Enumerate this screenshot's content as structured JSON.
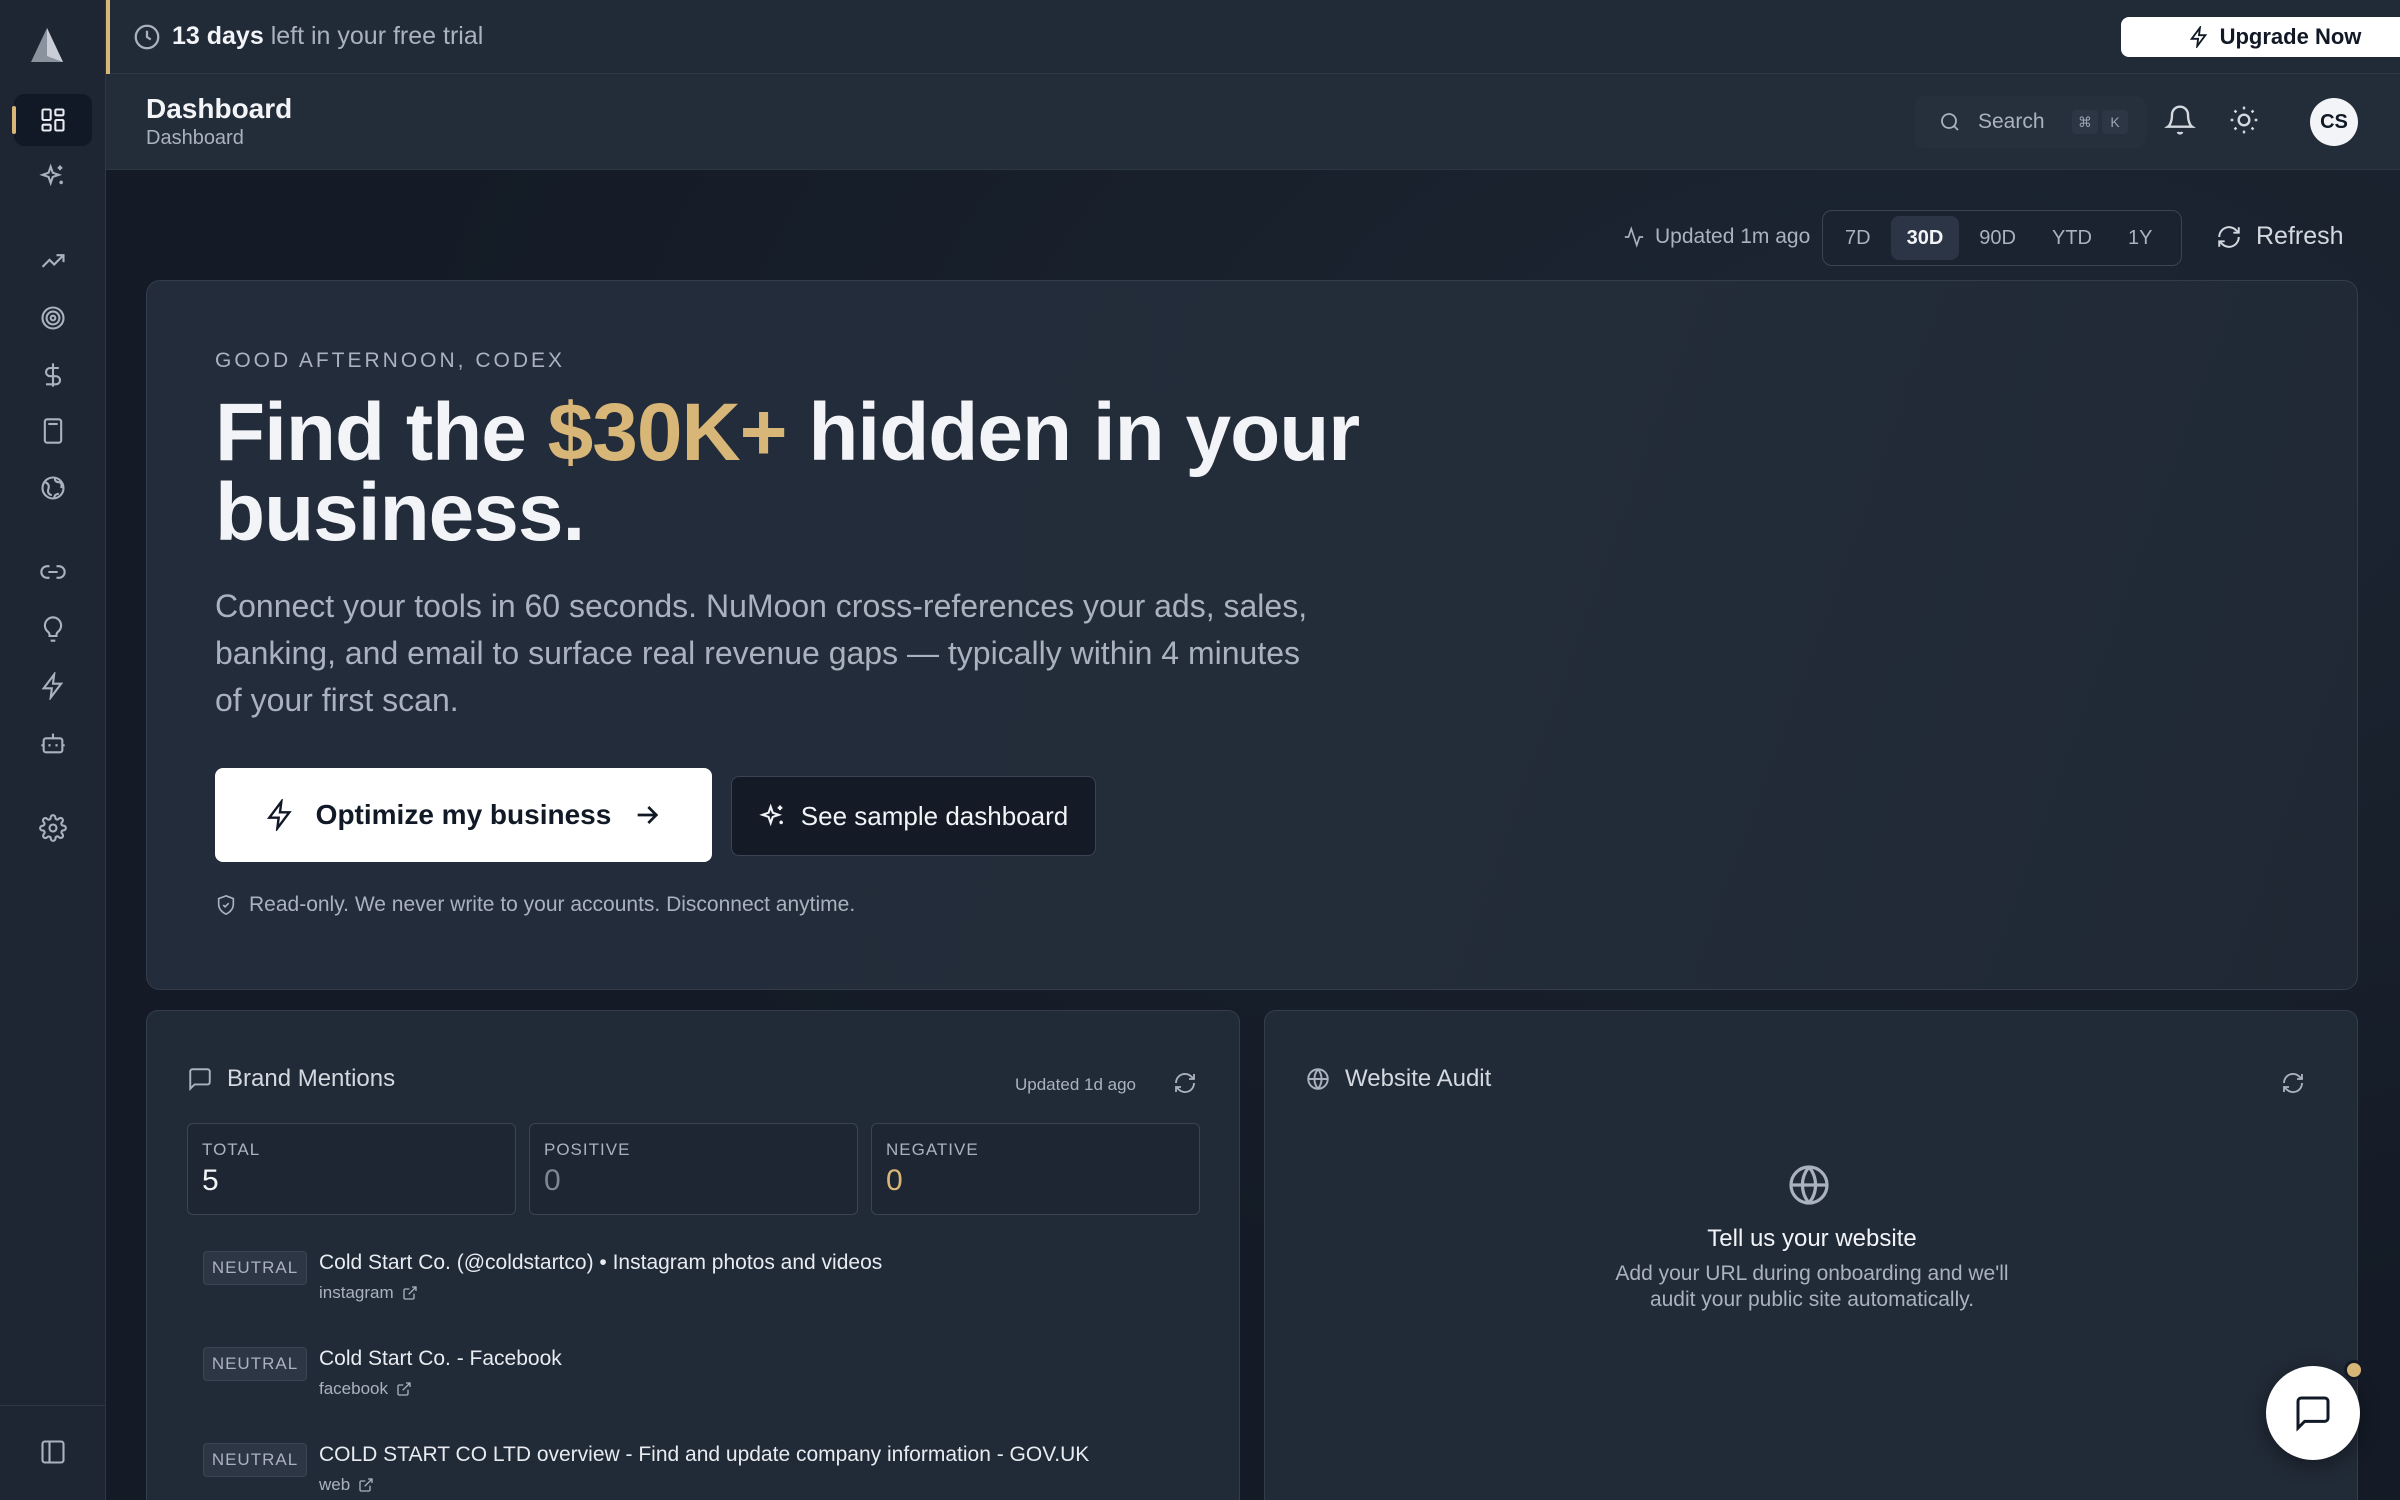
{
  "banner": {
    "trial_days": "13 days",
    "trial_suffix": " left in your free trial",
    "upgrade_label": "Upgrade Now"
  },
  "header": {
    "title": "Dashboard",
    "breadcrumb": "Dashboard",
    "search_label": "Search",
    "kbd_cmd": "⌘",
    "kbd_key": "K",
    "avatar_initials": "CS"
  },
  "sidebar": {
    "items": [
      {
        "name": "dashboard",
        "icon": "grid-icon",
        "active": true
      },
      {
        "name": "sparkles",
        "icon": "sparkles-icon"
      },
      {
        "name": "trends",
        "icon": "trending-up-icon"
      },
      {
        "name": "goals",
        "icon": "target-icon"
      },
      {
        "name": "revenue",
        "icon": "dollar-icon"
      },
      {
        "name": "calculator",
        "icon": "calculator-icon"
      },
      {
        "name": "market",
        "icon": "globe-icon"
      },
      {
        "name": "integrations",
        "icon": "link-icon"
      },
      {
        "name": "insights",
        "icon": "lightbulb-icon"
      },
      {
        "name": "automations",
        "icon": "bolt-icon"
      },
      {
        "name": "assistant",
        "icon": "bot-icon"
      },
      {
        "name": "settings",
        "icon": "gear-icon"
      }
    ]
  },
  "toolbar": {
    "updated_text": "Updated 1m ago",
    "ranges": [
      "7D",
      "30D",
      "90D",
      "YTD",
      "1Y"
    ],
    "active_range": "30D",
    "refresh_label": "Refresh"
  },
  "hero": {
    "greeting": "GOOD AFTERNOON, CODEX",
    "headline_pre": "Find the ",
    "headline_accent": "$30K+",
    "headline_post": " hidden in your business.",
    "lead": "Connect your tools in 60 seconds. NuMoon cross-references your ads, sales, banking, and email to surface real revenue gaps — typically within 4 minutes of your first scan.",
    "primary_cta": "Optimize my business",
    "secondary_cta": "See sample dashboard",
    "readonly_note": "Read-only. We never write to your accounts. Disconnect anytime."
  },
  "brand_mentions": {
    "title": "Brand Mentions",
    "updated": "Updated 1d ago",
    "stats": [
      {
        "label": "TOTAL",
        "value": "5",
        "color": "#f2f4f7"
      },
      {
        "label": "POSITIVE",
        "value": "0",
        "color": "#7d8693"
      },
      {
        "label": "NEGATIVE",
        "value": "0",
        "color": "#d8b677"
      }
    ],
    "items": [
      {
        "sentiment": "NEUTRAL",
        "title": "Cold Start Co. (@coldstartco) • Instagram photos and videos",
        "source": "instagram"
      },
      {
        "sentiment": "NEUTRAL",
        "title": "Cold Start Co. - Facebook",
        "source": "facebook"
      },
      {
        "sentiment": "NEUTRAL",
        "title": "COLD START CO LTD overview - Find and update company information - GOV.UK",
        "source": "web"
      }
    ]
  },
  "website_audit": {
    "title": "Website Audit",
    "empty_title": "Tell us your website",
    "empty_desc": "Add your URL during onboarding and we'll audit your public site automatically."
  },
  "colors": {
    "accent": "#d8b677",
    "background": "#141b26",
    "surface": "#212a37"
  }
}
